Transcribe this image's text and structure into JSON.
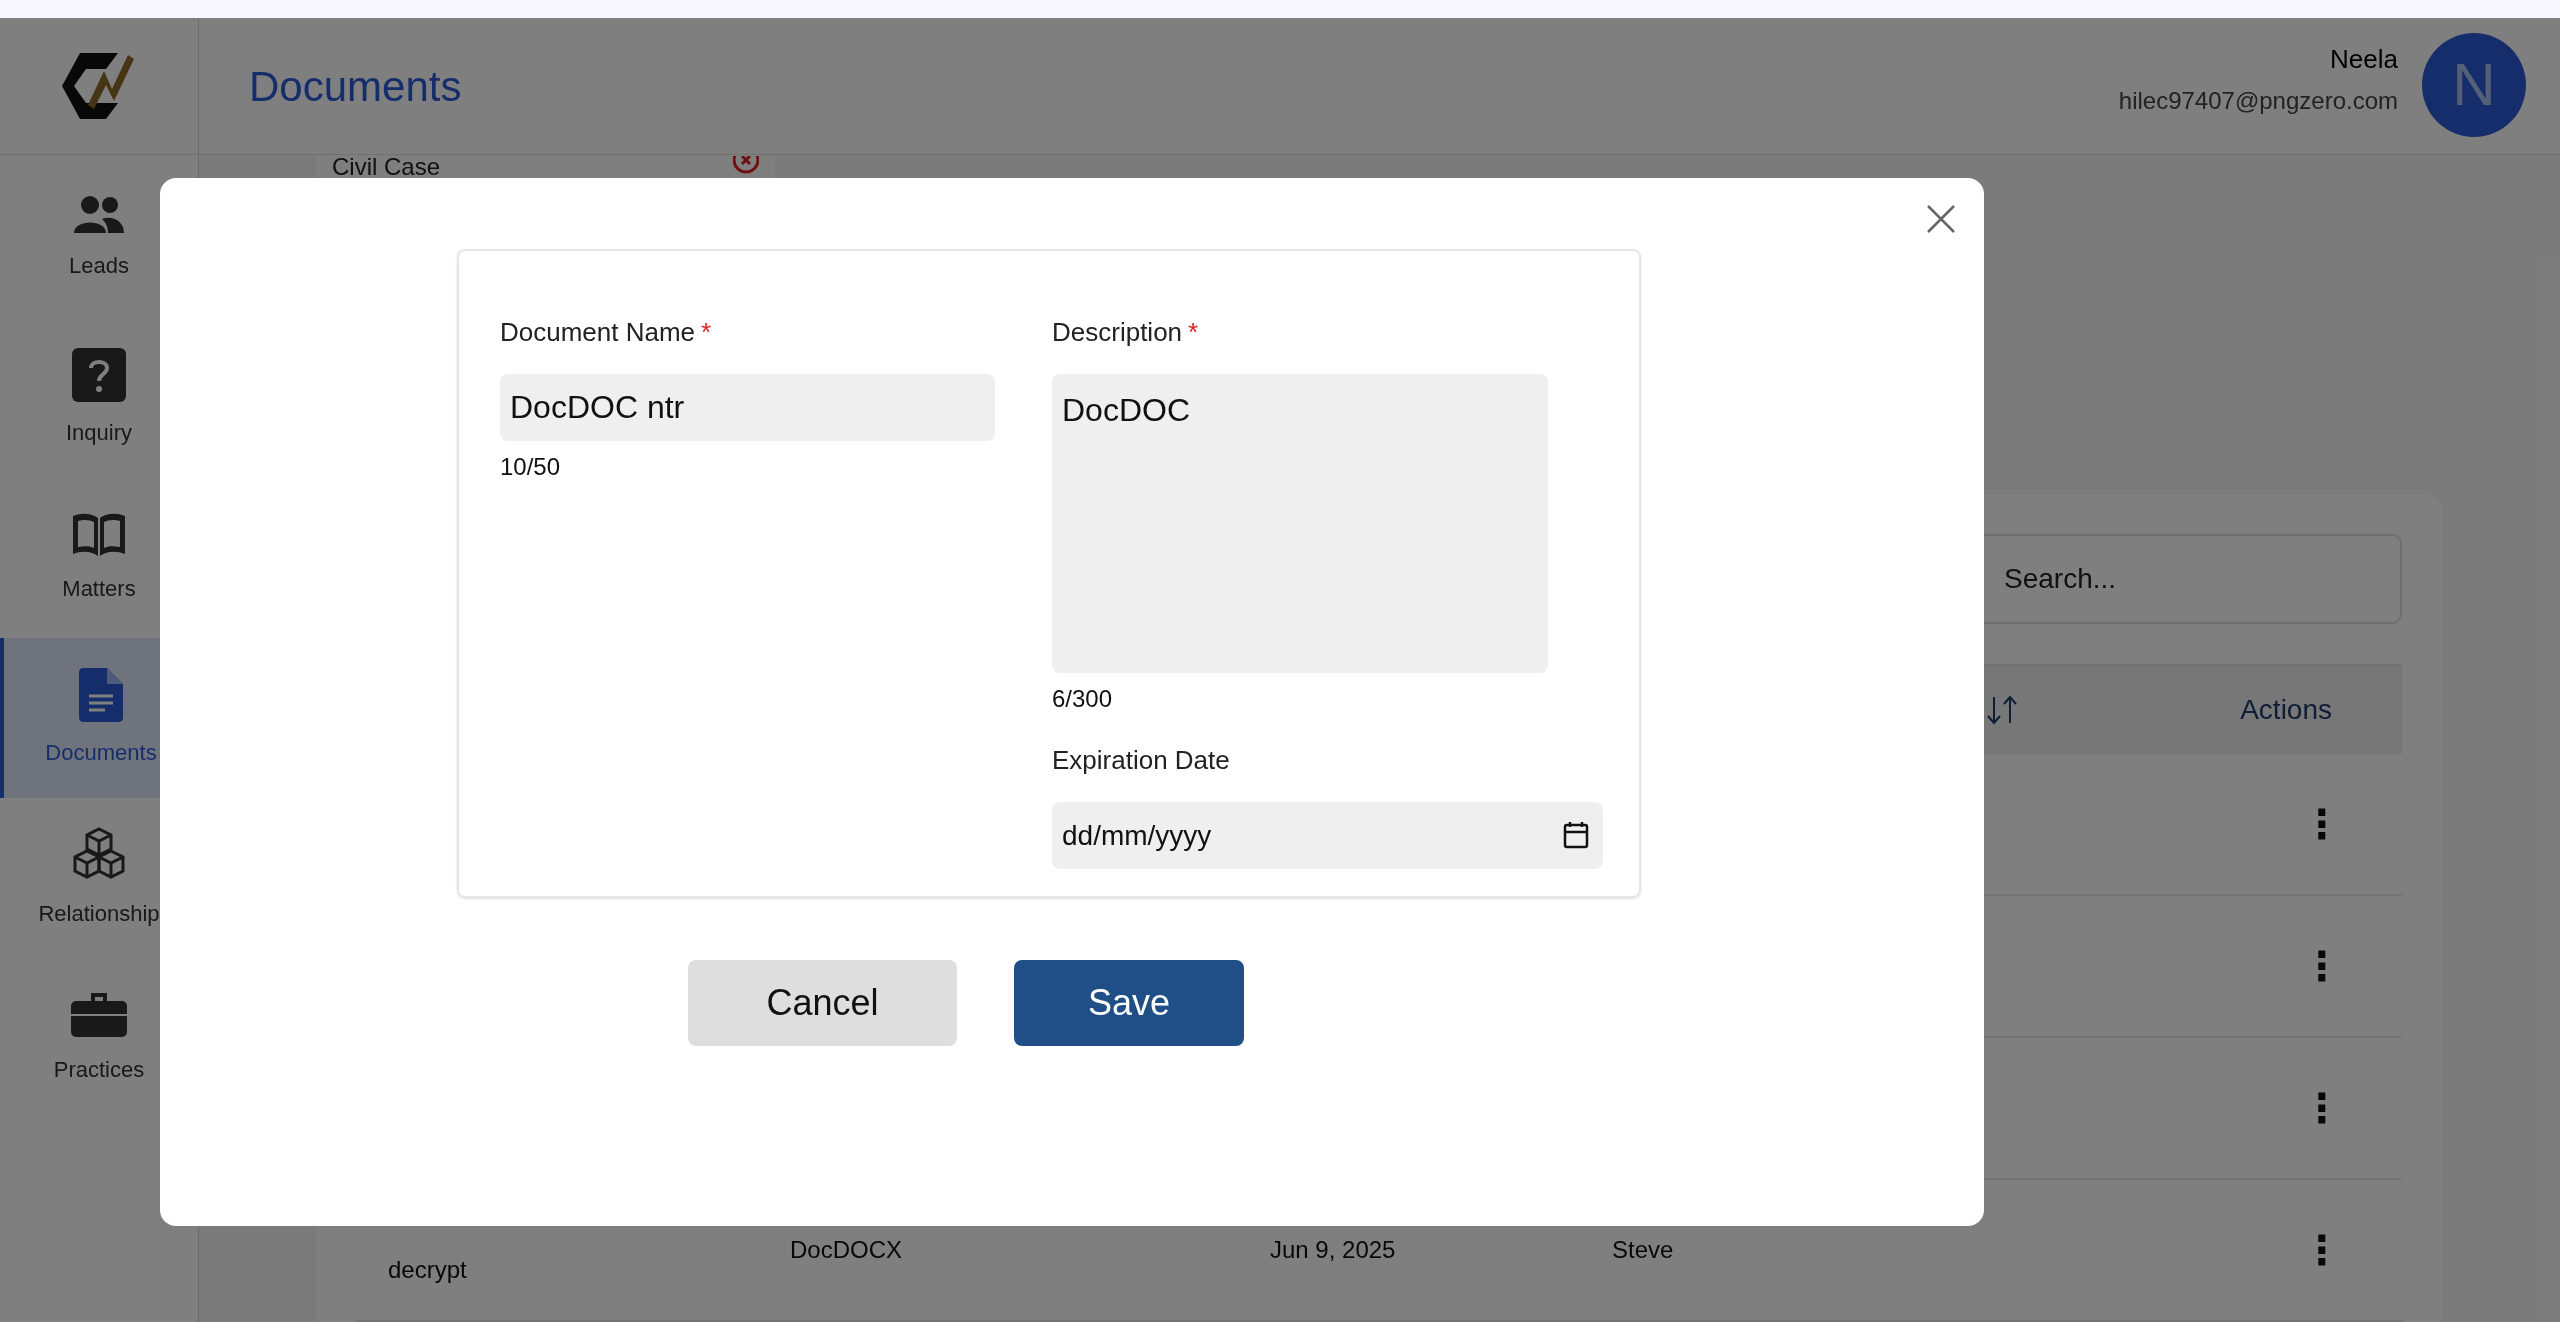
{
  "app": {
    "page_title": "Documents",
    "nav": [
      {
        "label": "Leads",
        "selected": false
      },
      {
        "label": "Inquiry",
        "selected": false
      },
      {
        "label": "Matters",
        "selected": false
      },
      {
        "label": "Documents",
        "selected": true
      },
      {
        "label": "Relationship",
        "selected": false
      },
      {
        "label": "Practices",
        "selected": false
      }
    ],
    "user": {
      "name": "Neela",
      "email": "hilec97407@pngzero.com",
      "initial": "N"
    }
  },
  "background": {
    "filter_chip": {
      "label": "Civil Case"
    },
    "search": {
      "placeholder": "Search..."
    },
    "table": {
      "actions_header": "Actions",
      "rows": [
        {
          "actions": "⋮"
        },
        {
          "actions": "⋮"
        },
        {
          "actions": "⋮"
        },
        {
          "actions": "⋮",
          "cells": [
            "decrypt",
            "DocDOCX",
            "Jun 9, 2025",
            "Steve"
          ]
        }
      ]
    }
  },
  "modal": {
    "fields": [
      {
        "kind": "text",
        "label": "Document Name",
        "required_mark": "*",
        "value": "DocDOC ntr",
        "counter": "10/50"
      },
      {
        "kind": "textarea",
        "label": "Description",
        "required_mark": "*",
        "value": "DocDOC",
        "counter": "6/300"
      },
      {
        "kind": "date",
        "label": "Expiration Date",
        "placeholder": "dd/mm/yyyy"
      }
    ],
    "buttons": [
      {
        "label": "Cancel",
        "kind": "secondary"
      },
      {
        "label": "Save",
        "kind": "primary"
      }
    ]
  }
}
